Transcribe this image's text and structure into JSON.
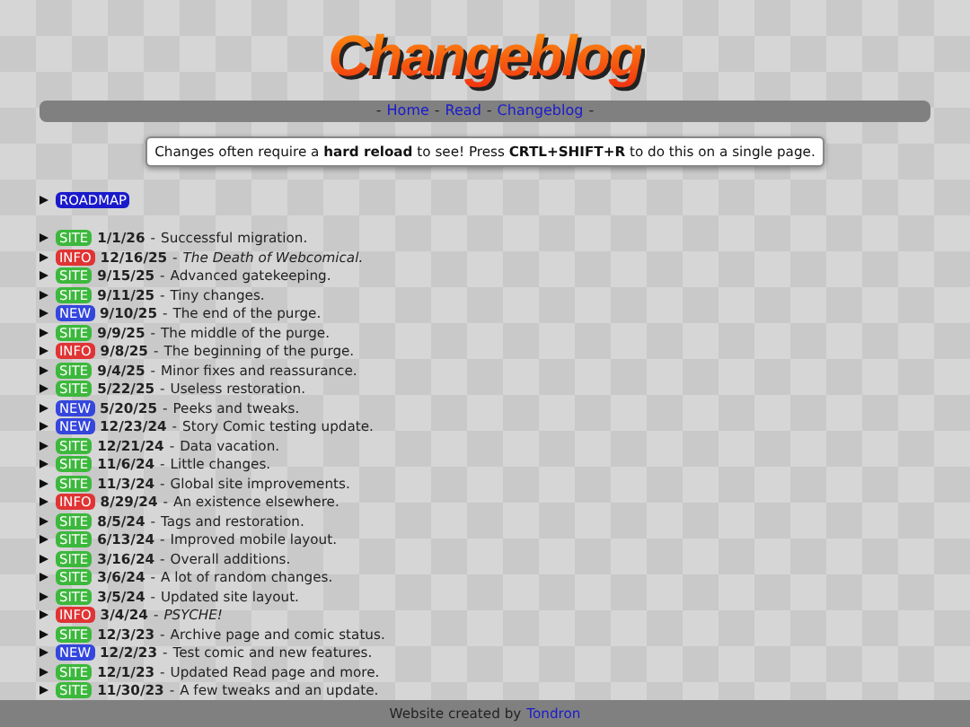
{
  "header": {
    "title": "Changeblog"
  },
  "nav": {
    "separator": "-",
    "links": [
      "Home",
      "Read",
      "Changeblog"
    ]
  },
  "notice": "Changes often require a **hard reload** to see! Press **CRTL+SHIFT+R** to do this on a single page.",
  "roadmap": {
    "label": "ROADMAP"
  },
  "entries": [
    {
      "tag": "SITE",
      "kind": "site",
      "date": "1/1/26",
      "text": "Successful migration.",
      "italic": false
    },
    {
      "tag": "INFO",
      "kind": "info",
      "date": "12/16/25",
      "text": "The Death of Webcomical.",
      "italic": true
    },
    {
      "tag": "SITE",
      "kind": "site",
      "date": "9/15/25",
      "text": "Advanced gatekeeping.",
      "italic": false
    },
    {
      "tag": "SITE",
      "kind": "site",
      "date": "9/11/25",
      "text": "Tiny changes.",
      "italic": false
    },
    {
      "tag": "NEW",
      "kind": "new",
      "date": "9/10/25",
      "text": "The end of the purge.",
      "italic": false
    },
    {
      "tag": "SITE",
      "kind": "site",
      "date": "9/9/25",
      "text": "The middle of the purge.",
      "italic": false
    },
    {
      "tag": "INFO",
      "kind": "info",
      "date": "9/8/25",
      "text": "The beginning of the purge.",
      "italic": false
    },
    {
      "tag": "SITE",
      "kind": "site",
      "date": "9/4/25",
      "text": "Minor fixes and reassurance.",
      "italic": false
    },
    {
      "tag": "SITE",
      "kind": "site",
      "date": "5/22/25",
      "text": "Useless restoration.",
      "italic": false
    },
    {
      "tag": "NEW",
      "kind": "new",
      "date": "5/20/25",
      "text": "Peeks and tweaks.",
      "italic": false
    },
    {
      "tag": "NEW",
      "kind": "new",
      "date": "12/23/24",
      "text": "Story Comic testing update.",
      "italic": false
    },
    {
      "tag": "SITE",
      "kind": "site",
      "date": "12/21/24",
      "text": "Data vacation.",
      "italic": false
    },
    {
      "tag": "SITE",
      "kind": "site",
      "date": "11/6/24",
      "text": "Little changes.",
      "italic": false
    },
    {
      "tag": "SITE",
      "kind": "site",
      "date": "11/3/24",
      "text": "Global site improvements.",
      "italic": false
    },
    {
      "tag": "INFO",
      "kind": "info",
      "date": "8/29/24",
      "text": "An existence elsewhere.",
      "italic": false
    },
    {
      "tag": "SITE",
      "kind": "site",
      "date": "8/5/24",
      "text": "Tags and restoration.",
      "italic": false
    },
    {
      "tag": "SITE",
      "kind": "site",
      "date": "6/13/24",
      "text": "Improved mobile layout.",
      "italic": false
    },
    {
      "tag": "SITE",
      "kind": "site",
      "date": "3/16/24",
      "text": "Overall additions.",
      "italic": false
    },
    {
      "tag": "SITE",
      "kind": "site",
      "date": "3/6/24",
      "text": "A lot of random changes.",
      "italic": false
    },
    {
      "tag": "SITE",
      "kind": "site",
      "date": "3/5/24",
      "text": "Updated site layout.",
      "italic": false
    },
    {
      "tag": "INFO",
      "kind": "info",
      "date": "3/4/24",
      "text": "PSYCHE!",
      "italic": true
    },
    {
      "tag": "SITE",
      "kind": "site",
      "date": "12/3/23",
      "text": "Archive page and comic status.",
      "italic": false
    },
    {
      "tag": "NEW",
      "kind": "new",
      "date": "12/2/23",
      "text": "Test comic and new features.",
      "italic": false
    },
    {
      "tag": "SITE",
      "kind": "site",
      "date": "12/1/23",
      "text": "Updated Read page and more.",
      "italic": false
    },
    {
      "tag": "SITE",
      "kind": "site",
      "date": "11/30/23",
      "text": "A few tweaks and an update.",
      "italic": false
    }
  ],
  "footer": {
    "text": "Website created by",
    "link": "Tondron"
  }
}
